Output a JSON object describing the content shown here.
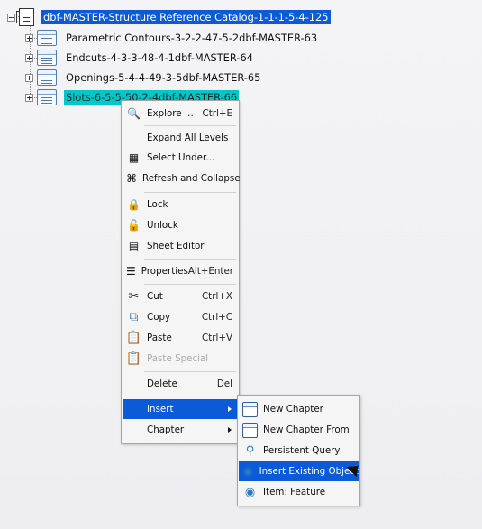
{
  "tree": {
    "root_label": "dbf-MASTER-Structure Reference Catalog-1-1-1-5-4-125",
    "children": [
      "Parametric Contours-3-2-2-47-5-2dbf-MASTER-63",
      "Endcuts-4-3-3-48-4-1dbf-MASTER-64",
      "Openings-5-4-4-49-3-5dbf-MASTER-65",
      "Slots-6-5-5-50-2-4dbf-MASTER-66"
    ]
  },
  "context_menu": {
    "items": [
      {
        "label": "Explore ...",
        "shortcut": "Ctrl+E",
        "icon": "explore-icon"
      },
      {
        "label": "Expand All Levels",
        "shortcut": "",
        "icon": ""
      },
      {
        "label": "Select Under...",
        "shortcut": "",
        "icon": "select-under-icon"
      },
      {
        "label": "Refresh and Collapse",
        "shortcut": "",
        "icon": "refresh-collapse-icon"
      },
      {
        "label": "Lock",
        "shortcut": "",
        "icon": "lock-icon"
      },
      {
        "label": "Unlock",
        "shortcut": "",
        "icon": "unlock-icon"
      },
      {
        "label": "Sheet Editor",
        "shortcut": "",
        "icon": "sheet-editor-icon"
      },
      {
        "label": "Properties",
        "shortcut": "Alt+Enter",
        "icon": "properties-icon"
      },
      {
        "label": "Cut",
        "shortcut": "Ctrl+X",
        "icon": "cut-icon"
      },
      {
        "label": "Copy",
        "shortcut": "Ctrl+C",
        "icon": "copy-icon"
      },
      {
        "label": "Paste",
        "shortcut": "Ctrl+V",
        "icon": "paste-icon"
      },
      {
        "label": "Paste Special",
        "shortcut": "",
        "icon": "paste-special-icon"
      },
      {
        "label": "Delete",
        "shortcut": "Del",
        "icon": ""
      },
      {
        "label": "Insert",
        "shortcut": "",
        "icon": ""
      },
      {
        "label": "Chapter",
        "shortcut": "",
        "icon": ""
      }
    ]
  },
  "submenu": {
    "items": [
      {
        "label": "New Chapter",
        "icon": "new-chapter-icon"
      },
      {
        "label": "New Chapter From",
        "icon": "new-chapter-from-icon"
      },
      {
        "label": "Persistent Query",
        "icon": "persistent-query-icon"
      },
      {
        "label": "Insert Existing Object",
        "icon": "insert-existing-object-icon"
      },
      {
        "label": "Item: Feature",
        "icon": "item-feature-icon"
      }
    ]
  },
  "colors": {
    "selection": "#0b5bd8",
    "highlight": "#00c8c8",
    "menu_background": "#f5f5f5"
  }
}
